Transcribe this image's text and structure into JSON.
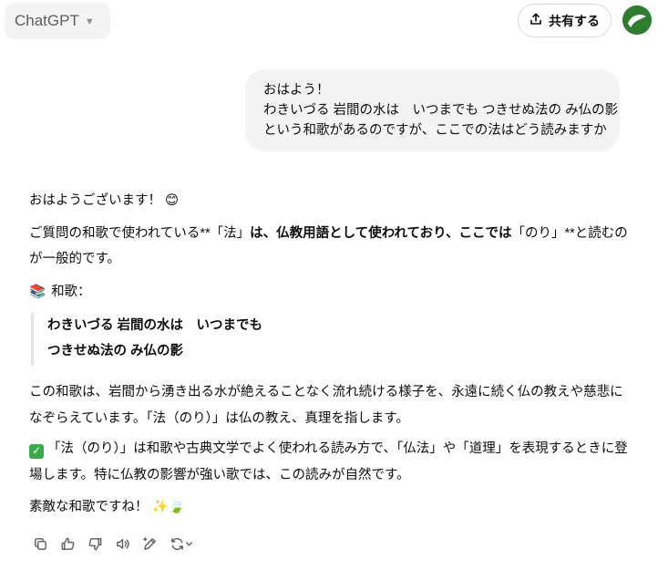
{
  "header": {
    "model_label": "ChatGPT",
    "share_label": "共有する"
  },
  "user_message": {
    "lines": [
      "おはよう！",
      "わきいづる 岩間の水は　いつまでも つきせぬ法の み仏の影",
      "という和歌があるのですが、ここでの法はどう読みますか"
    ]
  },
  "assistant": {
    "greeting": "おはようございます！",
    "greeting_emoji": "😊",
    "para2": {
      "part1": "ご質問の和歌で使われている**「法」",
      "part2_bold": "は、仏教用語として使われており、ここでは",
      "part3": "「のり」**と読むのが一般的です。"
    },
    "waka_heading_emoji": "📚",
    "waka_heading": "和歌：",
    "quote_lines": [
      "わきいづる 岩間の水は　いつまでも",
      "つきせぬ法の み仏の影"
    ],
    "para4": "この和歌は、岩間から湧き出る水が絶えることなく流れ続ける様子を、永遠に続く仏の教えや慈悲になぞらえています。「法（のり）」は仏の教え、真理を指します。",
    "para5_check": "✓",
    "para5": "「法（のり）」は和歌や古典文学でよく使われる読み方で、「仏法」や「道理」を表現するときに登場します。特に仏教の影響が強い歌では、この読みが自然です。",
    "closing": "素敵な和歌ですね！",
    "closing_emojis": "✨🍃"
  },
  "actions": [
    "copy-icon",
    "thumbs-up-icon",
    "thumbs-down-icon",
    "read-aloud-icon",
    "edit-in-canvas-icon",
    "regenerate-icon"
  ]
}
